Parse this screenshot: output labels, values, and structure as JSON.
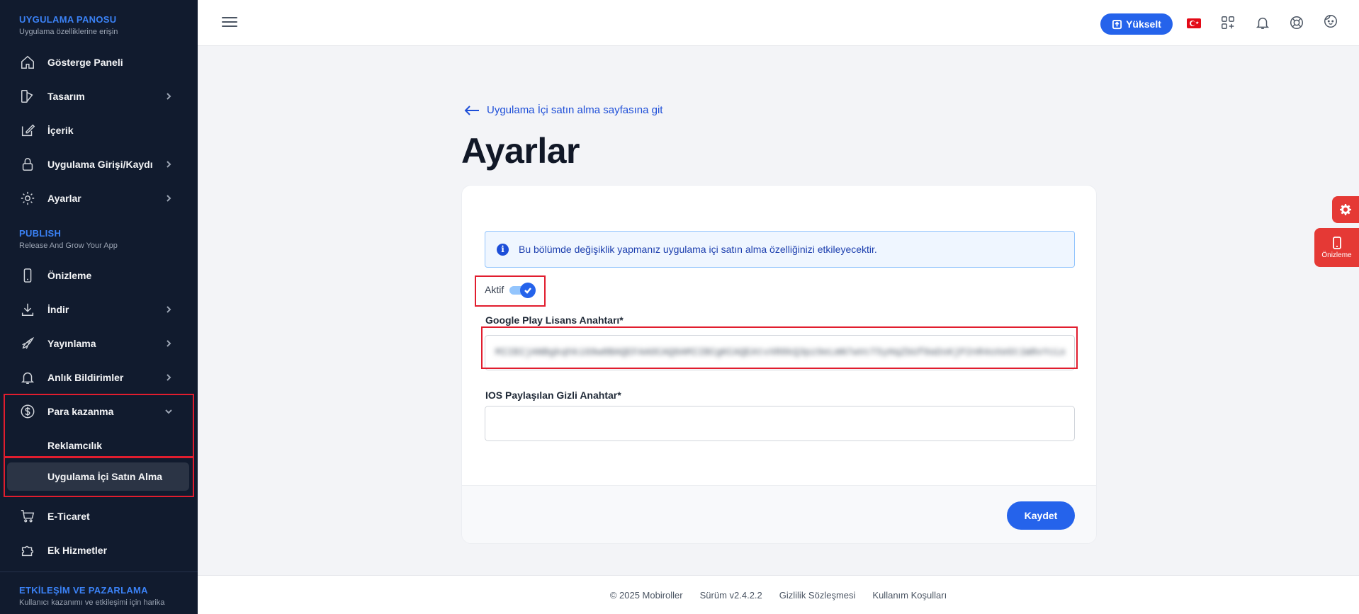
{
  "sidebar": {
    "app_section": {
      "title": "UYGULAMA PANOSU",
      "subtitle": "Uygulama özelliklerine erişin"
    },
    "items": [
      {
        "label": "Gösterge Paneli"
      },
      {
        "label": "Tasarım"
      },
      {
        "label": "İçerik"
      },
      {
        "label": "Uygulama Girişi/Kaydı"
      },
      {
        "label": "Ayarlar"
      },
      {
        "label": "Önizleme"
      },
      {
        "label": "İndir"
      },
      {
        "label": "Yayınlama"
      },
      {
        "label": "Anlık Bildirimler"
      },
      {
        "label": "Para kazanma"
      },
      {
        "label": "E-Ticaret"
      },
      {
        "label": "Ek Hizmetler"
      }
    ],
    "publish_section": {
      "title": "PUBLISH",
      "subtitle": "Release And Grow Your App"
    },
    "monetization_sub": [
      {
        "label": "Reklamcılık"
      },
      {
        "label": "Uygulama İçi Satın Alma"
      }
    ],
    "engagement_section": {
      "title": "ETKİLEŞİM VE PAZARLAMA",
      "subtitle": "Kullanıcı kazanımı ve etkileşimi için harika"
    }
  },
  "topbar": {
    "upgrade_label": "Yükselt",
    "language": "Türkçe",
    "icons": [
      "apps-icon",
      "bell-icon",
      "support-icon",
      "user-face-icon"
    ]
  },
  "main": {
    "back_link": "Uygulama İçi satın alma sayfasına git",
    "page_title": "Ayarlar",
    "alert_text": "Bu bölümde değişiklik yapmanız uygulama içi satın alma özelliğinizi etkileyecektir.",
    "toggle_label": "Aktif",
    "toggle_on": true,
    "google_label": "Google Play Lisans Anahtarı*",
    "google_value": "MIIBIjANBgkqhkiG9w0BAQEFAAOCAQ8AMIIBCgKCAQEAtvXR8kQ3pz9eLmN7wVcT5yHqZbUf0aDsKjP2nR4oXeGt1W8vYcLmB3sQpZ7",
    "ios_label": "IOS Paylaşılan Gizli Anahtar*",
    "ios_value": "",
    "save_label": "Kaydet"
  },
  "footer": {
    "copyright": "© 2025 Mobiroller",
    "version": "Sürüm v2.4.2.2",
    "privacy": "Gizlilik Sözleşmesi",
    "terms": "Kullanım Koşulları"
  },
  "floating": {
    "preview_label": "Önizleme"
  },
  "colors": {
    "accent": "#2563eb",
    "sidebar_bg": "#111b2e",
    "highlight": "#e11d2e",
    "floating": "#e53935"
  }
}
